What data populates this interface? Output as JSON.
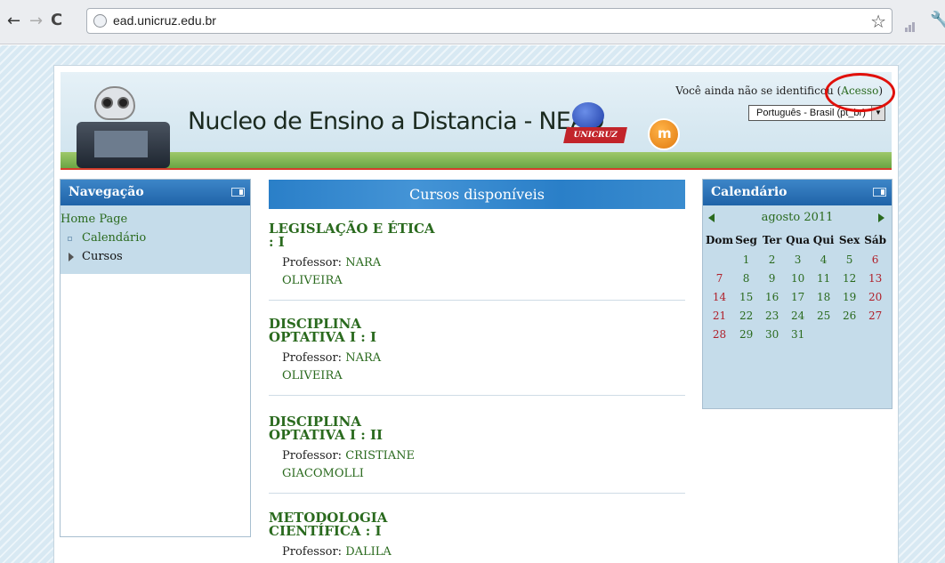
{
  "browser": {
    "url": "ead.unicruz.edu.br",
    "back_glyph": "←",
    "forward_glyph": "→",
    "reload_glyph": "C",
    "star_glyph": "☆",
    "wrench_glyph": "🔧"
  },
  "header": {
    "site_title": "Nucleo de Ensino a Distancia - NEAD",
    "logo_text": "UNICRUZ",
    "moodle_logo_letter": "m",
    "login_prefix": "Você ainda não se identificou (",
    "login_link": "Acesso",
    "login_suffix": ")",
    "language_selected": "Português - Brasil (pt_br)"
  },
  "navigation": {
    "title": "Navegação",
    "home": "Home Page",
    "items": [
      {
        "label": "Calendário"
      },
      {
        "label": "Cursos"
      }
    ]
  },
  "courses": {
    "title": "Cursos disponíveis",
    "professor_label": "Professor:",
    "list": [
      {
        "name_line1": "LEGISLAÇÃO E ÉTICA",
        "name_line2": ": I",
        "prof_line1": "NARA",
        "prof_line2": "OLIVEIRA"
      },
      {
        "name_line1": "DISCIPLINA",
        "name_line2": "OPTATIVA I : I",
        "prof_line1": "NARA",
        "prof_line2": "OLIVEIRA"
      },
      {
        "name_line1": "DISCIPLINA",
        "name_line2": "OPTATIVA I : II",
        "prof_line1": "CRISTIANE",
        "prof_line2": "GIACOMOLLI"
      },
      {
        "name_line1": "METODOLOGIA",
        "name_line2": "CIENTÍFICA : I",
        "prof_line1": "DALILA",
        "prof_line2": ""
      }
    ]
  },
  "calendar": {
    "title": "Calendário",
    "month": "agosto 2011",
    "weekdays": [
      "Dom",
      "Seg",
      "Ter",
      "Qua",
      "Qui",
      "Sex",
      "Sáb"
    ],
    "weeks": [
      [
        "",
        "1",
        "2",
        "3",
        "4",
        "5",
        "6"
      ],
      [
        "7",
        "8",
        "9",
        "10",
        "11",
        "12",
        "13"
      ],
      [
        "14",
        "15",
        "16",
        "17",
        "18",
        "19",
        "20"
      ],
      [
        "21",
        "22",
        "23",
        "24",
        "25",
        "26",
        "27"
      ],
      [
        "28",
        "29",
        "30",
        "31",
        "",
        "",
        ""
      ]
    ]
  },
  "colors": {
    "link_green": "#2a6a1e",
    "block_blue": "#1f63a8",
    "weekend_red": "#b0202a",
    "highlight_red": "#e0100a"
  }
}
